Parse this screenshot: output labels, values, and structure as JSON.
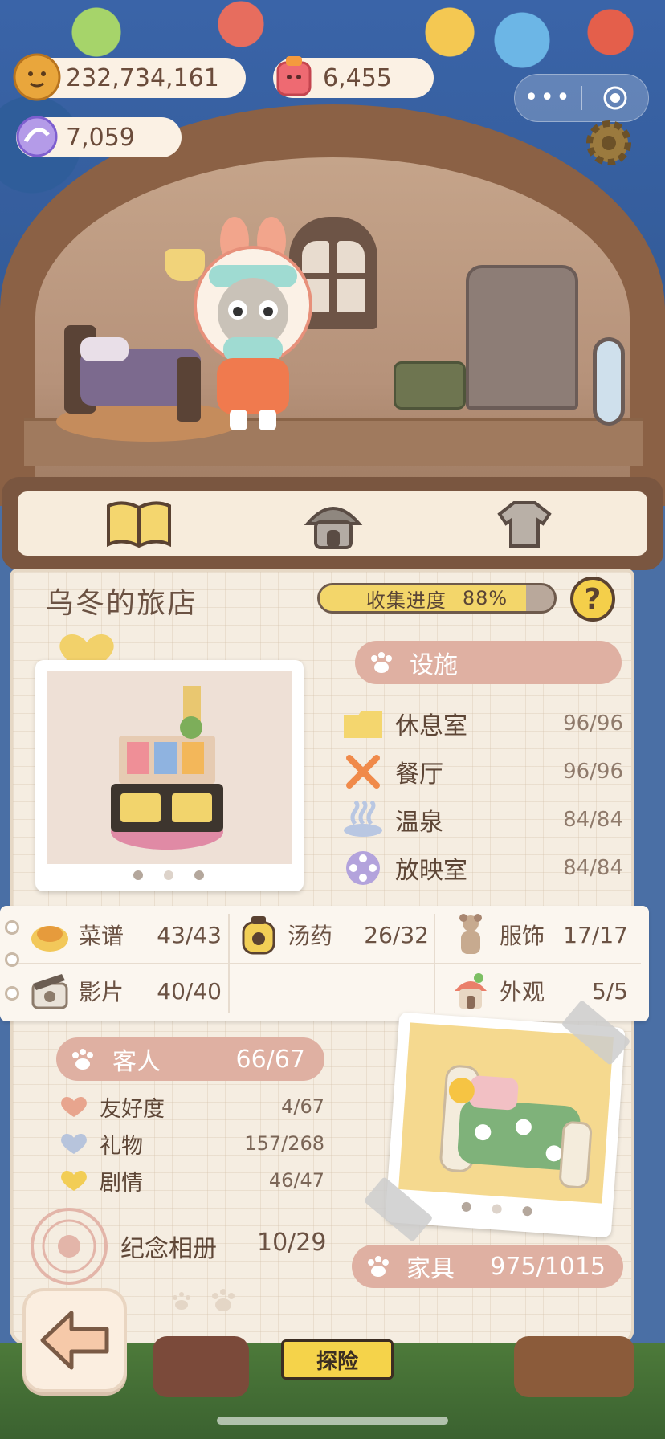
{
  "currency": {
    "gold": "232,734,161",
    "gem": "6,455",
    "candy": "7,059"
  },
  "wechat_capsule": {
    "more_icon": "more-dots-icon",
    "close_icon": "target-close-icon"
  },
  "tabs": [
    {
      "name": "book-icon",
      "active": true
    },
    {
      "name": "hotel-icon",
      "active": false
    },
    {
      "name": "clothes-icon",
      "active": false
    }
  ],
  "hotel": {
    "title": "乌冬的旅店",
    "progress_label": "收集进度",
    "progress_percent": "88%",
    "progress_value": 88,
    "help_label": "?"
  },
  "facilities": {
    "header": "设施",
    "items": [
      {
        "name": "休息室",
        "value": "96/96",
        "icon": "lounge-icon"
      },
      {
        "name": "餐厅",
        "value": "96/96",
        "icon": "restaurant-icon"
      },
      {
        "name": "温泉",
        "value": "84/84",
        "icon": "hot-spring-icon"
      },
      {
        "name": "放映室",
        "value": "84/84",
        "icon": "screening-room-icon"
      }
    ]
  },
  "collections": [
    {
      "name": "菜谱",
      "value": "43/43",
      "icon": "recipe-icon"
    },
    {
      "name": "汤药",
      "value": "26/32",
      "icon": "potion-icon"
    },
    {
      "name": "服饰",
      "value": "17/17",
      "icon": "outfit-icon"
    },
    {
      "name": "影片",
      "value": "40/40",
      "icon": "film-icon"
    },
    {
      "name": "外观",
      "value": "5/5",
      "icon": "exterior-icon"
    }
  ],
  "guests": {
    "header": "客人",
    "value": "66/67",
    "items": [
      {
        "name": "友好度",
        "value": "4/67",
        "color": "#e8a58e"
      },
      {
        "name": "礼物",
        "value": "157/268",
        "color": "#b7c4dc"
      },
      {
        "name": "剧情",
        "value": "46/47",
        "color": "#f2cd55"
      }
    ]
  },
  "album": {
    "label": "纪念相册",
    "value": "10/29"
  },
  "furniture": {
    "label": "家具",
    "value": "975/1015"
  },
  "bottom_sign": "探险",
  "colors": {
    "pill": "#dfb0a2",
    "panel": "#f5ede1",
    "frame": "#7a5640",
    "progress_fill": "#f3d66a"
  }
}
